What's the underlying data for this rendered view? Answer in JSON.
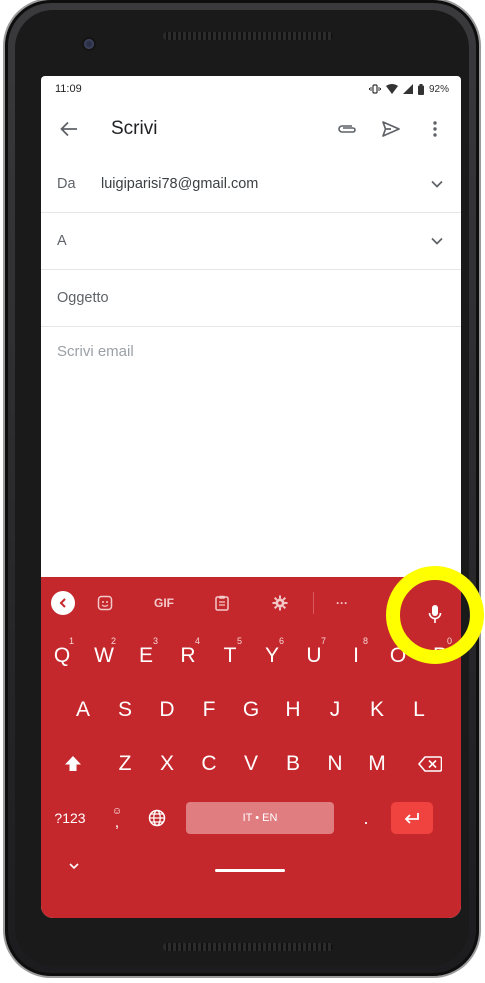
{
  "status_bar": {
    "time": "11:09",
    "battery": "92%"
  },
  "app_bar": {
    "title": "Scrivi",
    "icons": [
      "back-arrow-icon",
      "attach-icon",
      "send-icon",
      "more-vert-icon"
    ]
  },
  "compose": {
    "from_label": "Da",
    "from_value": "luigiparisi78@gmail.com",
    "to_label": "A",
    "subject_placeholder": "Oggetto",
    "body_placeholder": "Scrivi email"
  },
  "keyboard": {
    "toolbar": {
      "gif_label": "GIF",
      "more_label": "···"
    },
    "row1": [
      {
        "key": "Q",
        "hint": "1"
      },
      {
        "key": "W",
        "hint": "2"
      },
      {
        "key": "E",
        "hint": "3"
      },
      {
        "key": "R",
        "hint": "4"
      },
      {
        "key": "T",
        "hint": "5"
      },
      {
        "key": "Y",
        "hint": "6"
      },
      {
        "key": "U",
        "hint": "7"
      },
      {
        "key": "I",
        "hint": "8"
      },
      {
        "key": "O",
        "hint": "9"
      },
      {
        "key": "P",
        "hint": "0"
      }
    ],
    "row2": [
      "A",
      "S",
      "D",
      "F",
      "G",
      "H",
      "J",
      "K",
      "L"
    ],
    "row3": [
      "Z",
      "X",
      "C",
      "V",
      "B",
      "N",
      "M"
    ],
    "symbols_label": "?123",
    "comma_label": ",",
    "space_label": "IT • EN",
    "period_label": "."
  },
  "colors": {
    "keyboard_bg": "#c5282c",
    "enter_key": "#f0423f",
    "highlight": "#ffff00"
  }
}
